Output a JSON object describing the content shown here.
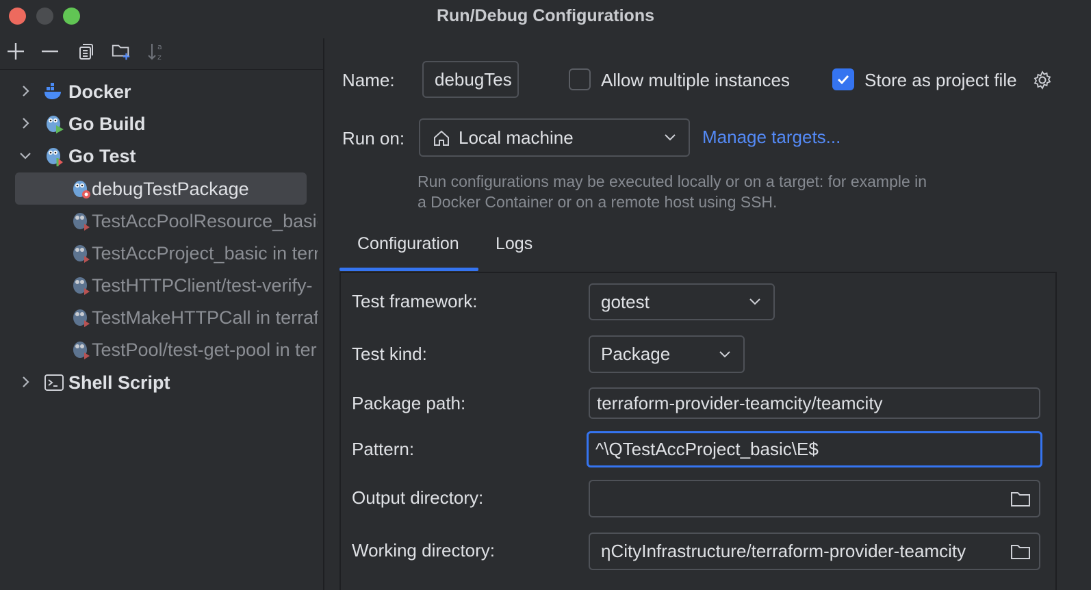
{
  "window": {
    "title": "Run/Debug Configurations"
  },
  "toolbar": {
    "add": "plus-icon",
    "remove": "minus-icon",
    "copy": "copy-icon",
    "folder": "new-folder-icon",
    "sort": "sort-alphabetically-icon"
  },
  "tree": {
    "groups": [
      {
        "label": "Docker",
        "icon": "docker-icon",
        "expanded": false
      },
      {
        "label": "Go Build",
        "icon": "go-build-icon",
        "expanded": false
      },
      {
        "label": "Go Test",
        "icon": "go-test-icon",
        "expanded": true
      },
      {
        "label": "Shell Script",
        "icon": "terminal-icon",
        "expanded": false
      }
    ],
    "go_test_items": [
      {
        "label": "debugTestPackage",
        "selected": true
      },
      {
        "label": "TestAccPoolResource_basic"
      },
      {
        "label": "TestAccProject_basic in terraform-provider-teamcity"
      },
      {
        "label": "TestHTTPClient/test-verify-"
      },
      {
        "label": "TestMakeHTTPCall in terraform"
      },
      {
        "label": "TestPool/test-get-pool in terraform"
      }
    ]
  },
  "form": {
    "name_label": "Name:",
    "name_value": "debugTes",
    "allow_multiple_label": "Allow multiple instances",
    "allow_multiple_checked": false,
    "store_project_label": "Store as project file",
    "store_project_checked": true,
    "run_on_label": "Run on:",
    "run_on_value": "Local machine",
    "manage_targets": "Manage targets...",
    "hint": "Run configurations may be executed locally or on a target: for example in a Docker Container or on a remote host using SSH."
  },
  "tabs": [
    {
      "label": "Configuration",
      "active": true
    },
    {
      "label": "Logs",
      "active": false
    }
  ],
  "config": {
    "framework_label": "Test framework:",
    "framework_value": "gotest",
    "kind_label": "Test kind:",
    "kind_value": "Package",
    "package_path_label": "Package path:",
    "package_path_value": "terraform-provider-teamcity/teamcity",
    "pattern_label": "Pattern:",
    "pattern_value": "^\\QTestAccProject_basic\\E$",
    "output_dir_label": "Output directory:",
    "output_dir_value": "",
    "working_dir_label": "Working directory:",
    "working_dir_value": "ηCityInfrastructure/terraform-provider-teamcity"
  },
  "colors": {
    "background": "#2b2d30",
    "accent": "#3574f0",
    "link": "#548af7",
    "selection": "#43454a"
  }
}
